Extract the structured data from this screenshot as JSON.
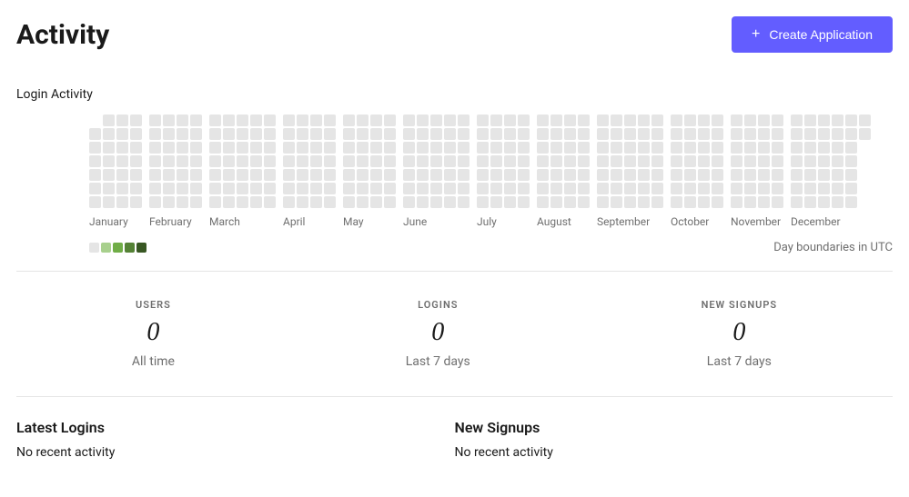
{
  "header": {
    "title": "Activity",
    "create_button": "Create Application"
  },
  "login_activity": {
    "label": "Login Activity",
    "boundary_note": "Day boundaries in UTC",
    "months": [
      "January",
      "February",
      "March",
      "April",
      "May",
      "June",
      "July",
      "August",
      "September",
      "October",
      "November",
      "December"
    ]
  },
  "stats": [
    {
      "title": "USERS",
      "value": "0",
      "sub": "All time"
    },
    {
      "title": "LOGINS",
      "value": "0",
      "sub": "Last 7 days"
    },
    {
      "title": "NEW SIGNUPS",
      "value": "0",
      "sub": "Last 7 days"
    }
  ],
  "latest_logins": {
    "title": "Latest Logins",
    "empty": "No recent activity"
  },
  "new_signups": {
    "title": "New Signups",
    "empty": "No recent activity"
  },
  "chart_data": {
    "type": "heatmap",
    "title": "Login Activity",
    "rows": 7,
    "row_meaning": "day_of_week",
    "columns_meaning": "week_of_year",
    "month_labels": [
      "January",
      "February",
      "March",
      "April",
      "May",
      "June",
      "July",
      "August",
      "September",
      "October",
      "November",
      "December"
    ],
    "legend_levels": 5,
    "all_values": 0,
    "note": "All cells show zero activity (grey). Leading cells before Jan 1 and trailing cells after Dec 31 are blank."
  }
}
